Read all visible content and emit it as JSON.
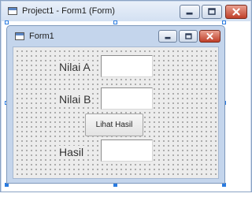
{
  "designer": {
    "title": "Project1 - Form1 (Form)"
  },
  "form": {
    "title": "Form1",
    "label_a": "Nilai A",
    "label_b": "Nilai B",
    "button_label": "Lihat Hasil",
    "label_hasil": "Hasil",
    "textbox_a_value": "",
    "textbox_b_value": "",
    "textbox_hasil_value": ""
  },
  "icons": {
    "form_icon": "form-icon",
    "minimize": "minimize-icon",
    "maximize": "maximize-icon",
    "close": "close-icon"
  },
  "colors": {
    "titlebar_bg": "#c8d7ec",
    "close_button": "#c0402a",
    "grid_bg": "#ececec",
    "selection_handle": "#2a7be0"
  }
}
